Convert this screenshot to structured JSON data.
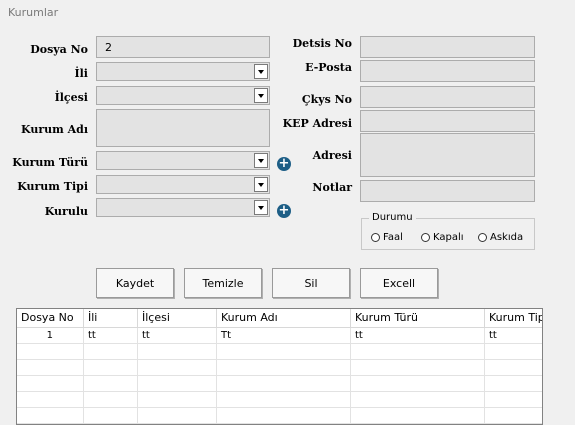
{
  "window": {
    "title": "Kurumlar"
  },
  "form": {
    "dosya_no": {
      "label": "Dosya No",
      "value": "2"
    },
    "il": {
      "label": "İli",
      "value": ""
    },
    "ilce": {
      "label": "İlçesi",
      "value": ""
    },
    "kurum_adi": {
      "label": "Kurum Adı",
      "value": ""
    },
    "kurum_turu": {
      "label": "Kurum Türü",
      "value": ""
    },
    "kurum_tipi": {
      "label": "Kurum Tipi",
      "value": ""
    },
    "kurulu": {
      "label": "Kurulu",
      "value": ""
    },
    "detsis_no": {
      "label": "Detsis  No",
      "value": ""
    },
    "eposta": {
      "label": "E-Posta",
      "value": ""
    },
    "cky_no": {
      "label": "Çkys No",
      "value": ""
    },
    "kep_adresi": {
      "label": "KEP Adresi",
      "value": ""
    },
    "adresi": {
      "label": "Adresi",
      "value": ""
    },
    "notlar": {
      "label": "Notlar",
      "value": ""
    }
  },
  "durumu": {
    "title": "Durumu",
    "options": [
      "Faal",
      "Kapalı",
      "Askıda"
    ]
  },
  "buttons": {
    "kaydet": "Kaydet",
    "temizle": "Temizle",
    "sil": "Sil",
    "excell": "Excell"
  },
  "grid": {
    "columns": [
      "Dosya No",
      "İli",
      "İlçesi",
      "Kurum Adı",
      "Kurum Türü",
      "Kurum Tipi"
    ],
    "rows": [
      [
        "1",
        "tt",
        "tt",
        "Tt",
        "tt",
        "tt"
      ]
    ]
  },
  "icons": {
    "add": "plus-circle-icon",
    "dropdown": "chevron-down-icon"
  }
}
